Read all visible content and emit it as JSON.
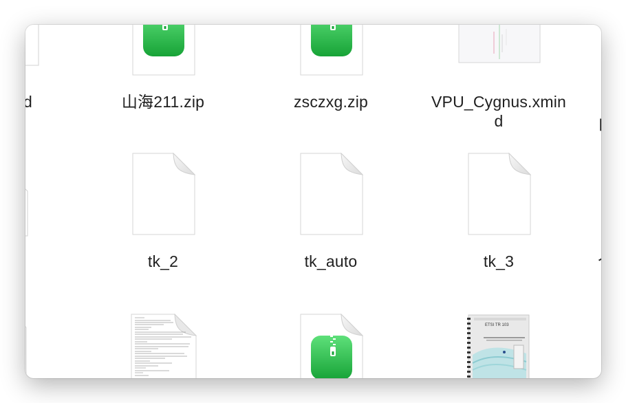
{
  "items": [
    {
      "name": "",
      "label_fragment": "d",
      "type": "document"
    },
    {
      "name": "山海211.zip",
      "type": "zip"
    },
    {
      "name": "zsczxg.zip",
      "type": "zip"
    },
    {
      "name": "VPU_Cygnus.xmind",
      "name_line1": "VPU_Cygnus.xmin",
      "name_line2": "d",
      "type": "xmind"
    },
    {
      "name": "",
      "label_fragment": "白",
      "type": "document"
    },
    {
      "name": "",
      "type": "document"
    },
    {
      "name": "tk_2",
      "type": "document"
    },
    {
      "name": "tk_auto",
      "type": "document"
    },
    {
      "name": "tk_3",
      "type": "document"
    },
    {
      "name": "",
      "label_fragment": "个",
      "type": "document"
    },
    {
      "name": "",
      "type": "document"
    },
    {
      "name": "",
      "type": "text-document"
    },
    {
      "name": "",
      "type": "zip"
    },
    {
      "name": "",
      "type": "pdf"
    }
  ],
  "icons": {
    "zip_color_top": "#5ee07a",
    "zip_color_bottom": "#17a337",
    "document_fill": "#ffffff",
    "fold_fill": "#e9e9e9",
    "pdf_cover_title": "ETSI TR 103"
  }
}
